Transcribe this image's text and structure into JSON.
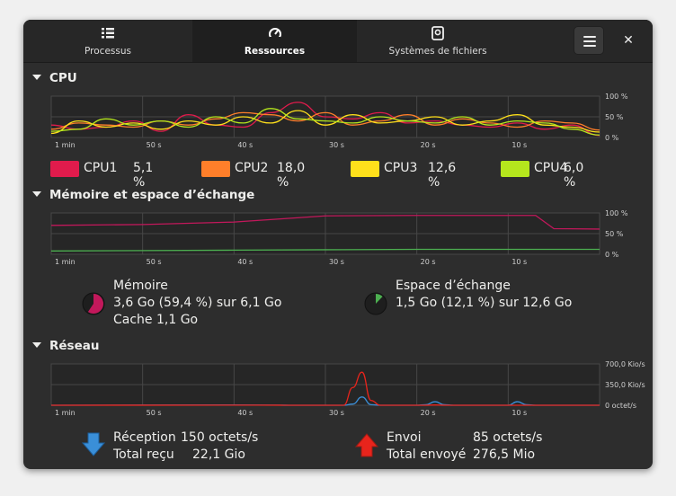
{
  "tabs": [
    {
      "label": "Processus",
      "icon": "list-icon"
    },
    {
      "label": "Ressources",
      "icon": "gauge-icon"
    },
    {
      "label": "Systèmes de fichiers",
      "icon": "disk-icon"
    }
  ],
  "window_buttons": {
    "close_label": "✕"
  },
  "cpu": {
    "title": "CPU",
    "x_ticks": [
      "1 min",
      "50 s",
      "40 s",
      "30 s",
      "20 s",
      "10 s"
    ],
    "y_ticks": [
      "100 %",
      "50 %",
      "0 %"
    ],
    "legend": [
      {
        "name": "CPU1",
        "value": "5,1 %",
        "color": "#e01b4c"
      },
      {
        "name": "CPU2",
        "value": "18,0 %",
        "color": "#ff7f2a"
      },
      {
        "name": "CPU3",
        "value": "12,6 %",
        "color": "#ffe01b"
      },
      {
        "name": "CPU4",
        "value": "6,0 %",
        "color": "#b5e61d"
      }
    ]
  },
  "memory": {
    "title": "Mémoire et espace d’échange",
    "x_ticks": [
      "1 min",
      "50 s",
      "40 s",
      "30 s",
      "20 s",
      "10 s"
    ],
    "y_ticks": [
      "100 %",
      "50 %",
      "0 %"
    ],
    "mem_label": "Mémoire",
    "mem_usage": "3,6 Go (59,4 %) sur 6,1 Go",
    "mem_cache": "Cache 1,1 Go",
    "mem_fraction": 0.594,
    "mem_color": "#c2185b",
    "swap_label": "Espace d’échange",
    "swap_usage": "1,5 Go (12,1 %) sur 12,6 Go",
    "swap_fraction": 0.121,
    "swap_color": "#4caf50"
  },
  "network": {
    "title": "Réseau",
    "x_ticks": [
      "1 min",
      "50 s",
      "40 s",
      "30 s",
      "20 s",
      "10 s"
    ],
    "y_ticks": [
      "700,0 Kio/s",
      "350,0 Kio/s",
      "0 octet/s"
    ],
    "rx_label": "Réception",
    "rx_rate": "150 octets/s",
    "rx_total_label": "Total reçu",
    "rx_total": "22,1 Gio",
    "tx_label": "Envoi",
    "tx_rate": "85 octets/s",
    "tx_total_label": "Total envoyé",
    "tx_total": "276,5 Mio"
  },
  "chart_data": [
    {
      "type": "line",
      "title": "CPU",
      "x": [
        -60,
        -57,
        -54,
        -51,
        -48,
        -45,
        -42,
        -39,
        -36,
        -33,
        -30,
        -27,
        -24,
        -21,
        -18,
        -15,
        -12,
        -9,
        -6,
        -3,
        0
      ],
      "ylim": [
        0,
        100
      ],
      "series": [
        {
          "name": "CPU1",
          "values": [
            30,
            20,
            25,
            40,
            15,
            55,
            30,
            25,
            60,
            85,
            50,
            45,
            60,
            35,
            40,
            30,
            25,
            35,
            20,
            30,
            5
          ]
        },
        {
          "name": "CPU2",
          "values": [
            20,
            35,
            30,
            25,
            40,
            30,
            45,
            60,
            55,
            40,
            60,
            30,
            40,
            55,
            30,
            45,
            35,
            25,
            40,
            35,
            18
          ]
        },
        {
          "name": "CPU3",
          "values": [
            10,
            40,
            25,
            35,
            20,
            40,
            30,
            50,
            35,
            65,
            30,
            55,
            35,
            40,
            50,
            30,
            40,
            55,
            30,
            25,
            13
          ]
        },
        {
          "name": "CPU4",
          "values": [
            15,
            20,
            45,
            30,
            40,
            25,
            50,
            35,
            70,
            45,
            40,
            35,
            50,
            40,
            35,
            50,
            30,
            40,
            35,
            20,
            6
          ]
        }
      ]
    },
    {
      "type": "line",
      "title": "Mémoire et espace d’échange",
      "x": [
        -60,
        -50,
        -40,
        -30,
        -20,
        -10,
        -7,
        -5,
        0
      ],
      "ylim": [
        0,
        100
      ],
      "series": [
        {
          "name": "Mémoire",
          "values": [
            70,
            72,
            78,
            93,
            94,
            94,
            94,
            62,
            61
          ]
        },
        {
          "name": "Espace d’échange",
          "values": [
            8,
            9,
            10,
            11,
            12,
            12,
            12,
            12,
            12
          ]
        }
      ]
    },
    {
      "type": "line",
      "title": "Réseau",
      "x": [
        -60,
        -40,
        -35,
        -34,
        -33,
        -30,
        -28,
        -27,
        -26,
        -25,
        -24,
        -22,
        -20,
        -19,
        -18,
        -17,
        -16,
        -10,
        -9,
        -8,
        -7,
        0
      ],
      "ylim": [
        0,
        700
      ],
      "series": [
        {
          "name": "Réception",
          "values": [
            0,
            5,
            2,
            0,
            0,
            0,
            0,
            20,
            140,
            10,
            0,
            0,
            0,
            10,
            60,
            10,
            0,
            0,
            60,
            10,
            0,
            0
          ]
        },
        {
          "name": "Envoi",
          "values": [
            0,
            2,
            1,
            0,
            0,
            0,
            0,
            300,
            560,
            80,
            0,
            0,
            0,
            0,
            5,
            0,
            0,
            0,
            0,
            0,
            0,
            0
          ]
        }
      ]
    }
  ]
}
